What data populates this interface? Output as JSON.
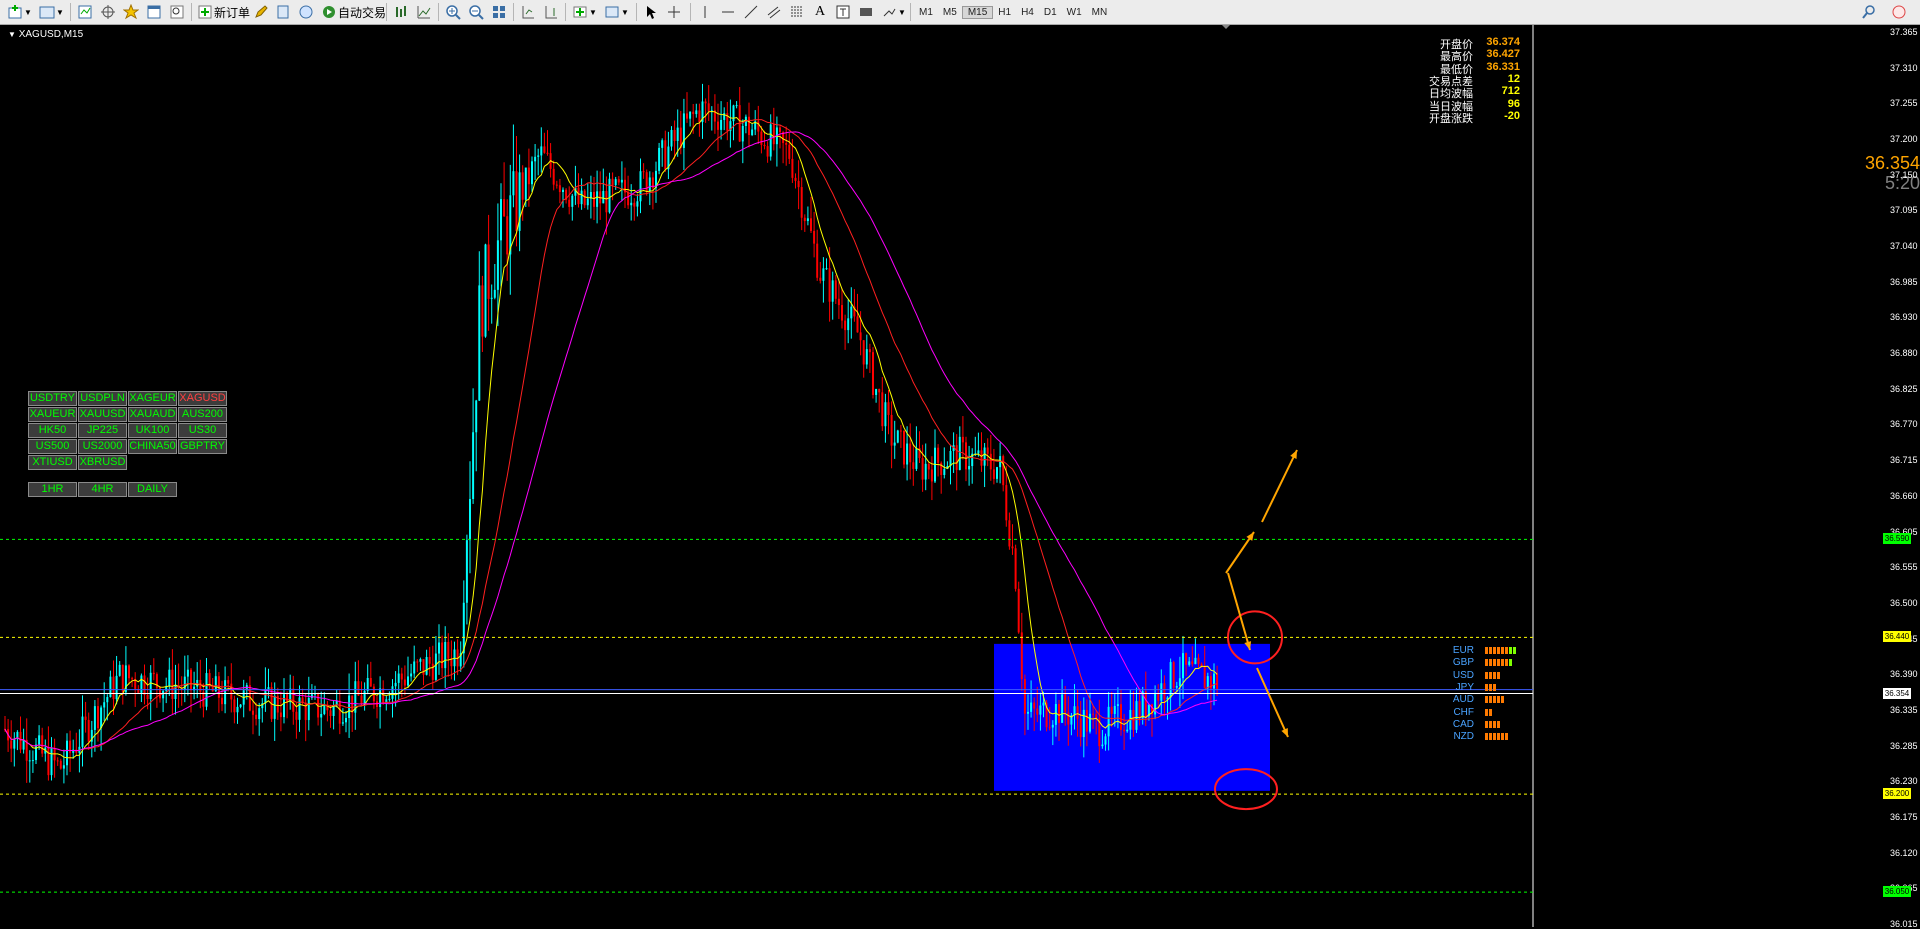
{
  "window": {
    "symbol_title": "XAGUSD,M15"
  },
  "toolbar": {
    "new_order_label": "新订单",
    "auto_trade_label": "自动交易",
    "timeframes": [
      "M1",
      "M5",
      "M15",
      "H1",
      "H4",
      "D1",
      "W1",
      "MN"
    ]
  },
  "symbols": {
    "rows": [
      [
        "USDTRY",
        "USDPLN",
        "XAGEUR",
        "XAGUSD"
      ],
      [
        "XAUEUR",
        "XAUUSD",
        "XAUAUD",
        "AUS200"
      ],
      [
        "HK50",
        "JP225",
        "UK100",
        "US30"
      ],
      [
        "US500",
        "US2000",
        "CHINA50",
        "GBPTRY"
      ],
      [
        "XTIUSD",
        "XBRUSD"
      ]
    ],
    "active": "XAGUSD",
    "periods": [
      "1HR",
      "4HR",
      "DAILY"
    ]
  },
  "info": {
    "labels": [
      "开盘价",
      "最高价",
      "最低价",
      "交易点差",
      "日均波幅",
      "当日波幅",
      "开盘涨跌"
    ],
    "values": [
      "36.374",
      "36.427",
      "36.331",
      "12",
      "712",
      "96",
      "-20"
    ],
    "value_colors": [
      "#ffa500",
      "#ffa500",
      "#ffa500",
      "#ffff00",
      "#ffff00",
      "#ffff00",
      "#ffff00"
    ],
    "current_price": "36.354",
    "countdown": "5:20"
  },
  "price_axis": {
    "ticks": [
      "37.365",
      "37.310",
      "37.255",
      "37.200",
      "37.150",
      "37.095",
      "37.040",
      "36.985",
      "36.930",
      "36.880",
      "36.825",
      "36.770",
      "36.715",
      "36.660",
      "36.605",
      "36.555",
      "36.500",
      "36.445",
      "36.390",
      "36.335",
      "36.285",
      "36.230",
      "36.175",
      "36.120",
      "36.065",
      "36.015"
    ],
    "levels": [
      {
        "price": "36.590",
        "color": "#00ff00"
      },
      {
        "price": "36.440",
        "color": "#ffff00"
      },
      {
        "price": "36.354",
        "color": "#ffffff"
      },
      {
        "price": "36.200",
        "color": "#ffff00"
      },
      {
        "price": "36.050",
        "color": "#00ff00"
      }
    ]
  },
  "currency_strength": {
    "names": [
      "EUR",
      "GBP",
      "USD",
      "JPY",
      "AUD",
      "CHF",
      "CAD",
      "NZD"
    ],
    "bars": [
      8,
      7,
      4,
      3,
      5,
      2,
      4,
      6
    ]
  },
  "colors": {
    "bull": "#00ffff",
    "bear": "#ff0000",
    "ma_fast": "#ffff00",
    "ma_mid": "#ff2020",
    "ma_slow": "#ff00ff",
    "zone": "#0000ff",
    "arrow": "#ffa500",
    "circle": "#ff2020"
  }
}
